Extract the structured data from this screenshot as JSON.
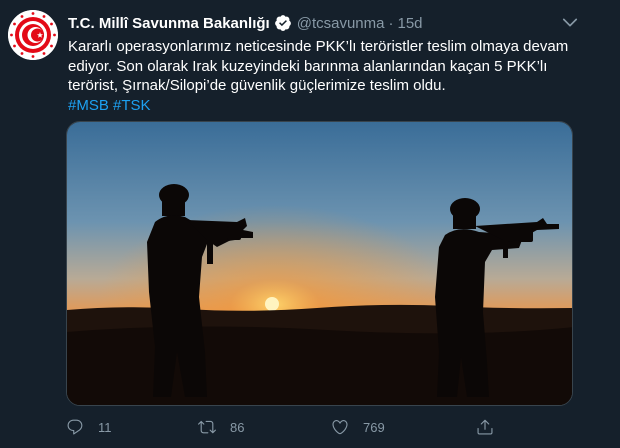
{
  "tweet": {
    "display_name": "T.C. Millî Savunma Bakanlığı",
    "handle": "@tcsavunma",
    "separator": "·",
    "time": "15d",
    "text_lines": [
      "Kararlı operasyonlarımız neticesinde PKK’lı teröristler teslim olmaya devam",
      "ediyor. Son olarak Irak kuzeyindeki barınma alanlarından kaçan 5 PKK’lı",
      "terörist, Şırnak/Silopi’de güvenlik güçlerimize teslim oldu."
    ],
    "hashtags": [
      "#MSB",
      "#TSK"
    ]
  },
  "media": {
    "description_icon": "photo-silhouettes-sunset"
  },
  "actions": {
    "reply_count": "11",
    "retweet_count": "86",
    "like_count": "769"
  },
  "colors": {
    "background": "#15202b",
    "text": "#ffffff",
    "muted": "#8899a6",
    "link": "#1da1f2",
    "border": "#38444d",
    "avatar_red": "#e30a17"
  },
  "icons": {
    "verified": "verified-badge-icon",
    "caret": "chevron-down-icon",
    "reply": "reply-icon",
    "retweet": "retweet-icon",
    "like": "heart-icon",
    "share": "share-icon"
  }
}
